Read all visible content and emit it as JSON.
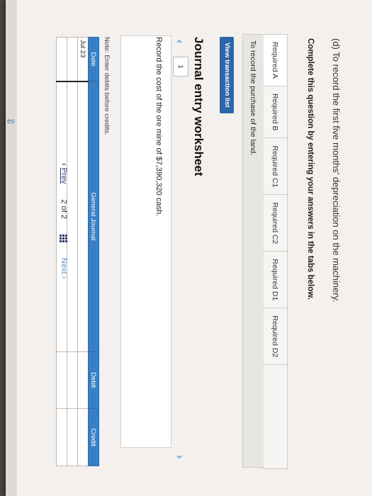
{
  "question": {
    "line": "(d) To record the first five months' depreciation on the machinery.",
    "instruction": "Complete this question by entering your answers in the tabs below."
  },
  "tabs": [
    {
      "label": "Required A"
    },
    {
      "label": "Required B"
    },
    {
      "label": "Required C1"
    },
    {
      "label": "Required C2"
    },
    {
      "label": "Required D1"
    },
    {
      "label": "Required D2"
    }
  ],
  "tab_panel_text": "To record the purchase of the land.",
  "view_button": "View transaction list",
  "worksheet": {
    "title": "Journal entry worksheet",
    "page": "1",
    "instruction": "Record the cost of the ore mine of $7,390,320 cash.",
    "note": "Note: Enter debits before credits."
  },
  "journal": {
    "headers": {
      "date": "Date",
      "general_journal": "General Journal",
      "debit": "Debit",
      "credit": "Credit"
    },
    "rows": [
      {
        "date": "Jul 23"
      },
      {
        "date": ""
      },
      {
        "date": ""
      }
    ]
  },
  "pagination": {
    "prev": "Prev",
    "count": "2 of 2",
    "next": "Next"
  },
  "left_edge_text": "es",
  "colors": {
    "accent_blue": "#2f66a8",
    "table_header": "#3a7fc4"
  }
}
